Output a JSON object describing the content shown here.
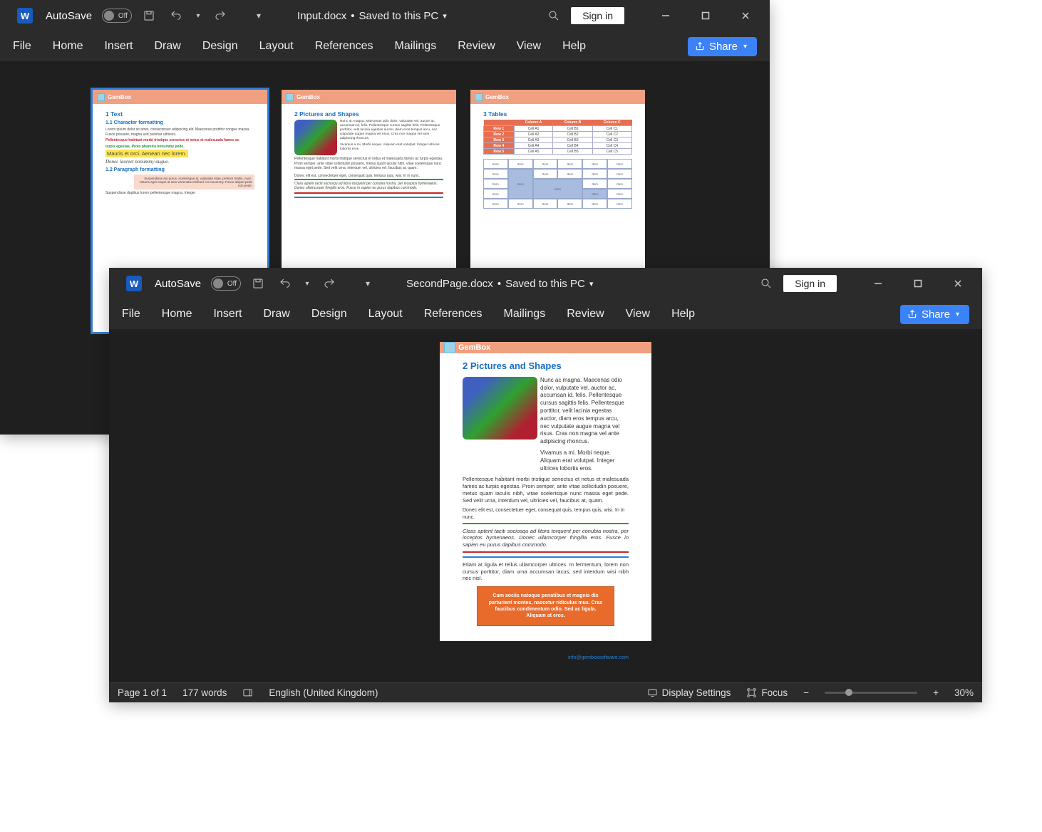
{
  "window1": {
    "app_icon_letter": "W",
    "autosave_label": "AutoSave",
    "toggle_state": "Off",
    "doc_name": "Input.docx",
    "save_status": "Saved to this PC",
    "signin": "Sign in",
    "menu": [
      "File",
      "Home",
      "Insert",
      "Draw",
      "Design",
      "Layout",
      "References",
      "Mailings",
      "Review",
      "View",
      "Help"
    ],
    "share": "Share",
    "brand": "GemBox",
    "thumbs": {
      "page1": {
        "h1": "1  Text",
        "h2a": "1.1  Character formatting",
        "p1": "Lorem ipsum dolor sit amet, consectetuer adipiscing elit. Maecenas porttitor congue massa. Fusce posuere, magna sed pulvinar ultricies.",
        "p_red": "Pellentesque habitant morbi tristique senectus et netus et malesuada fames ac",
        "p_green": "turpis egestas. Proin pharetra nonummy pede.",
        "p_mark": "Mauris et orci. Aenean nec lorem.",
        "p_script": "Donec laoreet nonummy augue.",
        "h2b": "1.2  Paragraph formatting",
        "box": "Suspendisse dui purus, scelerisque at, vulputate vitae, pretium mattis, nunc. Mauris eget neque at sem venenatis eleifend. Ut nonummy. Fusce aliquet pede non pede.",
        "p_bottom": "Suspendisse dapibus lorem pellentesque magna. Integer"
      },
      "page2": {
        "h1": "2  Pictures and Shapes",
        "dice_txt": "Nunc ac magna. Maecenas odio dolor, vulputate vel, auctor ac, accumsan id, felis. Pellentesque cursus sagittis felis. Pellentesque porttitor, velit lacinia egestas auctor, diam eros tempus arcu, nec vulputate augue magna vel risus. Cras non magna vel ante adipiscing rhoncus.",
        "dice_txt2": "Vivamus a mi. Morbi neque. Aliquam erat volutpat. Integer ultrices lobortis eros.",
        "p_after": "Pellentesque habitant morbi tristique senectus et netus et malesuada fames ac turpis egestas. Proin semper, ante vitae sollicitudin posuere, metus quam iaculis nibh, vitae scelerisque nunc massa eget pede. Sed velit urna, interdum vel, ultricies vel, faucibus at, quam.",
        "rule_green": "Donec elit est, consectetuer eget, consequat quis, tempus quis, wisi. In in nunc.",
        "p_italic": "Class aptent taciti sociosqu ad litora torquent per conubia nostra, per inceptos hymenaeos. Donec ullamcorper fringilla eros. Fusce in sapien eu purus dapibus commodo."
      },
      "page3": {
        "h1": "3  Tables",
        "cols": [
          "",
          "Column A",
          "Column B",
          "Column C"
        ],
        "rows": [
          [
            "Row 1",
            "Cell A1",
            "Cell B1",
            "Cell C1"
          ],
          [
            "Row 2",
            "Cell A2",
            "Cell B2",
            "Cell C2"
          ],
          [
            "Row 3",
            "Cell A3",
            "Cell B3",
            "Cell C3"
          ],
          [
            "Row 4",
            "Cell A4",
            "Cell B4",
            "Cell C4"
          ],
          [
            "Row 5",
            "Cell A5",
            "Cell B5",
            "Cell C5"
          ]
        ],
        "item": "Item"
      }
    }
  },
  "window2": {
    "app_icon_letter": "W",
    "autosave_label": "AutoSave",
    "toggle_state": "Off",
    "doc_name": "SecondPage.docx",
    "save_status": "Saved to this PC",
    "signin": "Sign in",
    "menu": [
      "File",
      "Home",
      "Insert",
      "Draw",
      "Design",
      "Layout",
      "References",
      "Mailings",
      "Review",
      "View",
      "Help"
    ],
    "share": "Share",
    "brand": "GemBox",
    "page": {
      "h1": "2  Pictures and Shapes",
      "col_txt": "Nunc ac magna. Maecenas odio dolor, vulputate vel, auctor ac, accumsan id, felis. Pellentesque cursus sagittis felis. Pellentesque porttitor, velit lacinia egestas auctor, diam eros tempus arcu, nec vulputate augue magna vel risus. Cras non magna vel ante adipiscing rhoncus.",
      "col_txt2": "Vivamus a mi. Morbi neque. Aliquam erat volutpat. Integer ultrices lobortis eros.",
      "p1": "Pellentesque habitant morbi tristique senectus et netus et malesuada fames ac turpis egestas. Proin semper, ante vitae sollicitudin posuere, metus quam iaculis nibh, vitae scelerisque nunc massa eget pede. Sed velit urna, interdum vel, ultricies vel, faucibus at, quam.",
      "rule_green": "Donec elit est, consectetuer eget, consequat quis, tempus quis, wisi. In in nunc.",
      "p_italic": "Class aptent taciti sociosqu ad litora torquent per conubia nostra, per inceptos hymenaeos. Donec ullamcorper fringilla eros. Fusce in sapien eu purus dapibus commodo.",
      "p2": "Etiam at ligula et tellus ullamcorper ultrices. In fermentum, lorem non cursus porttitor, diam urna accumsan lacus, sed interdum wisi nibh nec nisl.",
      "orange": "Cum sociis natoque penatibus et magnis dis parturient montes, nascetur ridiculus mus. Cras faucibus condimentum odio. Sed ac ligula. Aliquam at eros.",
      "footer_link": "info@gemboxsoftware.com"
    },
    "status": {
      "page": "Page 1 of 1",
      "words": "177 words",
      "lang": "English (United Kingdom)",
      "display": "Display Settings",
      "focus": "Focus",
      "zoom": "30%"
    }
  }
}
